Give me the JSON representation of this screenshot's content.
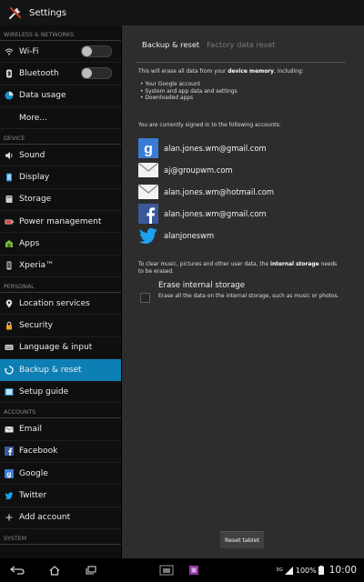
{
  "window": {
    "title": "Settings"
  },
  "sidebar": {
    "sections": {
      "wireless": "WIRELESS & NETWORKS",
      "device": "DEVICE",
      "personal": "PERSONAL",
      "accounts": "ACCOUNTS",
      "system": "SYSTEM"
    },
    "items": {
      "wifi": "Wi-Fi",
      "bluetooth": "Bluetooth",
      "data_usage": "Data usage",
      "more": "More...",
      "sound": "Sound",
      "display": "Display",
      "storage": "Storage",
      "power": "Power management",
      "apps": "Apps",
      "xperia": "Xperia™",
      "location": "Location services",
      "security": "Security",
      "language": "Language & input",
      "backup": "Backup & reset",
      "setup": "Setup guide",
      "email": "Email",
      "facebook": "Facebook",
      "google": "Google",
      "twitter": "Twitter",
      "add_account": "Add account"
    },
    "selected": "backup",
    "toggles": {
      "wifi": "off",
      "bluetooth": "off"
    },
    "accent_color": "#0e7fb5"
  },
  "main": {
    "tabs": {
      "active": "Backup & reset",
      "inactive": "Factory data reset"
    },
    "intro_pre": "This will erase all data from your ",
    "intro_bold": "device memory",
    "intro_post": ", including:",
    "bullets": [
      "• Your Google account",
      "• System and app data and settings",
      "• Downloaded apps"
    ],
    "accounts_heading": "You are currently signed in to the following accounts:",
    "accounts": [
      {
        "email": "alan.jones.wm@gmail.com",
        "icon": "google-icon"
      },
      {
        "email": "aj@groupwm.com",
        "icon": "email-icon"
      },
      {
        "email": "alan.jones.wm@hotmail.com",
        "icon": "email-icon"
      },
      {
        "email": "alan.jones.wm@gmail.com",
        "icon": "facebook-icon"
      },
      {
        "email": "alanjoneswm",
        "icon": "twitter-icon"
      }
    ],
    "storage_note_pre": "To clear music, pictures and other user data, the ",
    "storage_note_bold": "internal storage",
    "storage_note_post": " needs to be erased.",
    "erase": {
      "label": "Erase internal storage",
      "desc": "Erase all the data on the internal storage, such as music or photos.",
      "checked": false
    },
    "reset_button": "Reset tablet"
  },
  "statusbar": {
    "signal": "3G",
    "battery": "100%",
    "time": "10:00"
  }
}
